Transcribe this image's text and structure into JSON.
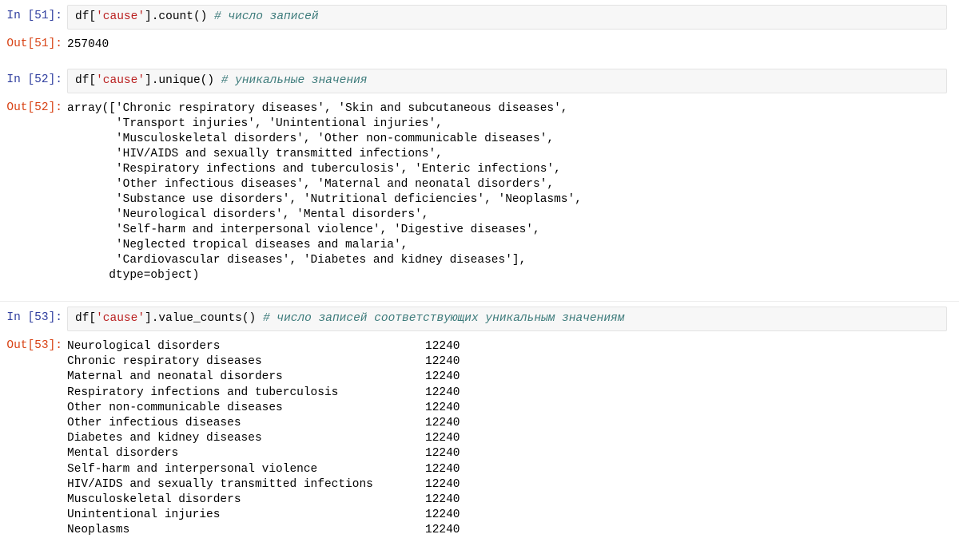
{
  "notebook": {
    "cells": [
      {
        "id": "cell-51",
        "in_prompt": "In [51]:",
        "out_prompt": "Out[51]:",
        "code": {
          "pre_string": "df[",
          "string": "'cause'",
          "post_string": "].count() ",
          "comment": "# число записей"
        },
        "output_text": "257040"
      },
      {
        "id": "cell-52",
        "in_prompt": "In [52]:",
        "out_prompt": "Out[52]:",
        "code": {
          "pre_string": "df[",
          "string": "'cause'",
          "post_string": "].unique() ",
          "comment": "# уникальные значения"
        },
        "output_text": "array(['Chronic respiratory diseases', 'Skin and subcutaneous diseases',\n       'Transport injuries', 'Unintentional injuries',\n       'Musculoskeletal disorders', 'Other non-communicable diseases',\n       'HIV/AIDS and sexually transmitted infections',\n       'Respiratory infections and tuberculosis', 'Enteric infections',\n       'Other infectious diseases', 'Maternal and neonatal disorders',\n       'Substance use disorders', 'Nutritional deficiencies', 'Neoplasms',\n       'Neurological disorders', 'Mental disorders',\n       'Self-harm and interpersonal violence', 'Digestive diseases',\n       'Neglected tropical diseases and malaria',\n       'Cardiovascular diseases', 'Diabetes and kidney diseases'],\n      dtype=object)"
      },
      {
        "id": "cell-53",
        "in_prompt": "In [53]:",
        "out_prompt": "Out[53]:",
        "code": {
          "pre_string": "df[",
          "string": "'cause'",
          "post_string": "].value_counts() ",
          "comment": "# число записей соответствующих уникальным значениям"
        },
        "value_counts": [
          {
            "label": "Neurological disorders",
            "count": "12240"
          },
          {
            "label": "Chronic respiratory diseases",
            "count": "12240"
          },
          {
            "label": "Maternal and neonatal disorders",
            "count": "12240"
          },
          {
            "label": "Respiratory infections and tuberculosis",
            "count": "12240"
          },
          {
            "label": "Other non-communicable diseases",
            "count": "12240"
          },
          {
            "label": "Other infectious diseases",
            "count": "12240"
          },
          {
            "label": "Diabetes and kidney diseases",
            "count": "12240"
          },
          {
            "label": "Mental disorders",
            "count": "12240"
          },
          {
            "label": "Self-harm and interpersonal violence",
            "count": "12240"
          },
          {
            "label": "HIV/AIDS and sexually transmitted infections",
            "count": "12240"
          },
          {
            "label": "Musculoskeletal disorders",
            "count": "12240"
          },
          {
            "label": "Unintentional injuries",
            "count": "12240"
          },
          {
            "label": "Neoplasms",
            "count": "12240"
          }
        ]
      }
    ]
  },
  "colors": {
    "prompt_in": "#303f9f",
    "prompt_out": "#d84315",
    "string": "#ba2121",
    "comment": "#3d7b7b",
    "input_background": "#f7f7f7",
    "input_border": "#e3e3e3",
    "text": "#000000"
  }
}
